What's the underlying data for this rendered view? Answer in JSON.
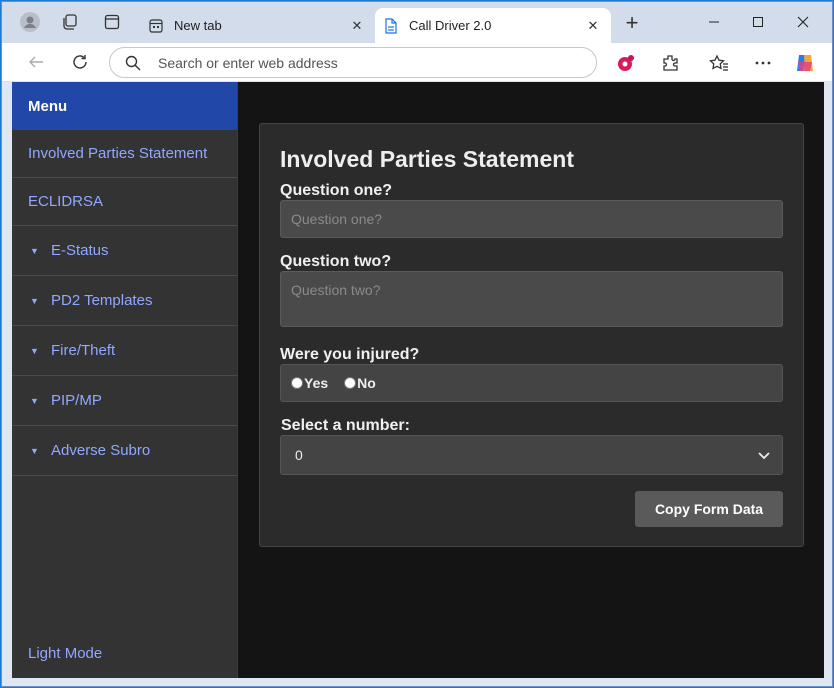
{
  "browser": {
    "tabs": [
      {
        "title": "New tab",
        "icon": "new-tab-page-icon"
      },
      {
        "title": "Call Driver 2.0",
        "icon": "document-icon"
      }
    ],
    "address_placeholder": "Search or enter web address"
  },
  "sidebar": {
    "heading": "Menu",
    "items": [
      {
        "label": "Involved Parties Statement",
        "expandable": false
      },
      {
        "label": "ECLIDRSA",
        "expandable": false
      },
      {
        "label": "E-Status",
        "expandable": true
      },
      {
        "label": "PD2 Templates",
        "expandable": true
      },
      {
        "label": "Fire/Theft",
        "expandable": true
      },
      {
        "label": "PIP/MP",
        "expandable": true
      },
      {
        "label": "Adverse Subro",
        "expandable": true
      }
    ],
    "footer_link": "Light Mode"
  },
  "form": {
    "title": "Involved Parties Statement",
    "q1_label": "Question one?",
    "q1_placeholder": "Question one?",
    "q2_label": "Question two?",
    "q2_placeholder": "Question two?",
    "injured_label": "Were you injured?",
    "radio_yes": "Yes",
    "radio_no": "No",
    "select_label": "Select a number:",
    "select_value": "0",
    "copy_button": "Copy Form Data"
  },
  "colors": {
    "menu_header": "#2147a8",
    "link": "#90a8ff",
    "page_bg": "#141414",
    "card_bg": "#2b2b2b"
  }
}
